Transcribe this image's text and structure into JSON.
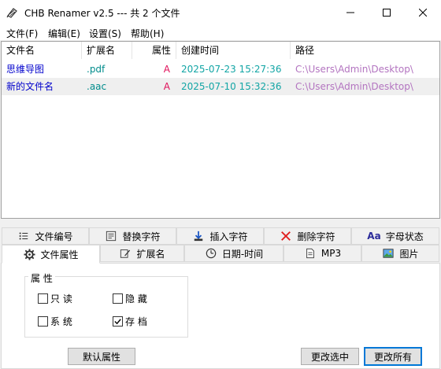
{
  "window": {
    "title": "CHB Renamer v2.5 --- 共 2 个文件"
  },
  "menu": [
    "文件(F)",
    "编辑(E)",
    "设置(S)",
    "帮助(H)"
  ],
  "list": {
    "columns": [
      "文件名",
      "扩展名",
      "属性",
      "创建时间",
      "路径"
    ],
    "rows": [
      {
        "name": "思维导图",
        "ext": ".pdf",
        "attr": "A",
        "time": "2025-07-23 15:27:36",
        "path": "C:\\Users\\Admin\\Desktop\\"
      },
      {
        "name": "新的文件名",
        "ext": ".aac",
        "attr": "A",
        "time": "2025-07-10 15:32:36",
        "path": "C:\\Users\\Admin\\Desktop\\"
      }
    ]
  },
  "tabs_row1": [
    {
      "label": "文件编号",
      "icon": "list-numbered-icon"
    },
    {
      "label": "替换字符",
      "icon": "replace-icon"
    },
    {
      "label": "插入字符",
      "icon": "insert-icon"
    },
    {
      "label": "删除字符",
      "icon": "delete-x-icon"
    },
    {
      "label": "字母状态",
      "icon": "letter-case-icon",
      "icon_text": "Aa"
    }
  ],
  "tabs_row2": [
    {
      "label": "文件属性",
      "icon": "gear-icon"
    },
    {
      "label": "扩展名",
      "icon": "edit-icon"
    },
    {
      "label": "日期-时间",
      "icon": "clock-icon"
    },
    {
      "label": "MP3",
      "icon": "document-icon"
    },
    {
      "label": "图片",
      "icon": "picture-icon"
    }
  ],
  "attributes": {
    "group_title": "属 性",
    "readonly": {
      "label": "只 读",
      "checked": false
    },
    "hidden": {
      "label": "隐 藏",
      "checked": false
    },
    "system": {
      "label": "系 统",
      "checked": false
    },
    "archive": {
      "label": "存 档",
      "checked": true
    }
  },
  "buttons": {
    "default_attr": "默认属性",
    "change_selected": "更改选中",
    "change_all": "更改所有"
  },
  "colors": {
    "name": "#0000cc",
    "ext": "#008c8c",
    "attr": "#e0105a",
    "time": "#12a5a5",
    "path": "#b374c0",
    "focus": "#0078d7"
  }
}
